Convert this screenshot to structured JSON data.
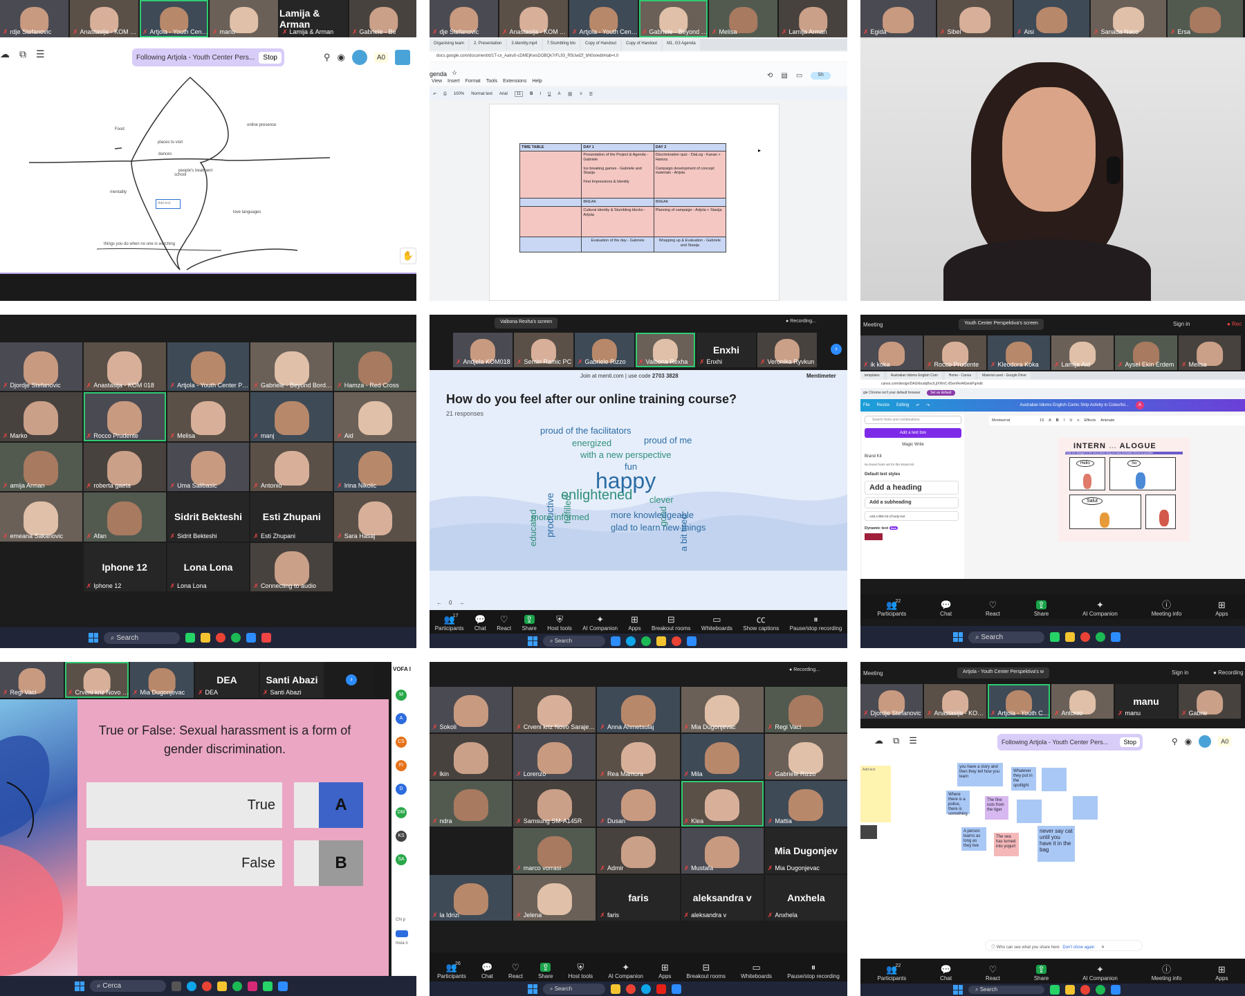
{
  "p1": {
    "participants": [
      {
        "name": "rdje Stefanovic"
      },
      {
        "name": "Anastasija - KOM 018"
      },
      {
        "name": "Artjola - Youth Center ..."
      },
      {
        "name": "manu"
      },
      {
        "name": "Lamija & Arman",
        "display": "Lamija & Arman"
      },
      {
        "name": "Gabriele - Be"
      }
    ],
    "follow_text": "Following Artjola - Youth Center Pers...",
    "stop_label": "Stop",
    "ao_label": "A0",
    "map_labels": [
      "Food",
      "online presence",
      "places to visit",
      "dances",
      "people's treatment",
      "school",
      "mentality",
      "Add text",
      "love languages",
      "things you do when no one is watching"
    ]
  },
  "p2": {
    "participants": [
      {
        "name": "dje Stefanovic"
      },
      {
        "name": "Anastasija - KOM 018"
      },
      {
        "name": "Artjola - Youth Center ..."
      },
      {
        "name": "Gabriele - Beyond Borders"
      },
      {
        "name": "Melisa"
      },
      {
        "name": "Lamija Arman"
      }
    ],
    "tabs": [
      "Organising team",
      "2. Presentation",
      "3.Identity.mp4",
      "7.Stumbling blo",
      "Copy of Handout",
      "Copy of Handout",
      "M1, G3 Agenda"
    ],
    "url": "docs.google.com/document/d/1T-cx_Aalru0-cDMEjKwsDOBQk7rFL93_R5UwlZf_bN0o/edit#tab=t.0",
    "doc_title": "genda",
    "menu": [
      "View",
      "Insert",
      "Format",
      "Tools",
      "Extensions",
      "Help"
    ],
    "format_bar": {
      "zoom": "100%",
      "style": "Normal text",
      "font": "Arial",
      "size": "11"
    },
    "table": {
      "headers": [
        "TIME TABLE",
        "DAY 1",
        "DAY 2"
      ],
      "rows": [
        {
          "day1": "Presentation of the Project & Agenda - Gabriele\n\nIce breaking games - Gabriele and Stasija\n\nFirst Impressions & Identity",
          "day2": "Discrimination quiz - DiaLog - Kanan + Hamza\n\nCampaign development of concept materials - Artjola",
          "type": "pink"
        },
        {
          "day1": "BREAK",
          "day2": "BREAK",
          "type": "blue"
        },
        {
          "day1": "Cultural identity & Stumbling blocks - Artjola",
          "day2": "Planning of campaign - Artjola + Stasija",
          "type": "pink"
        },
        {
          "day1": "Evaluation of the day - Gabriele",
          "day2": "Wrapping up & Evaluation - Gabriele and Stasija",
          "type": "blue"
        }
      ]
    }
  },
  "p3": {
    "participants": [
      {
        "name": "Egida"
      },
      {
        "name": "Sibel"
      },
      {
        "name": "Aisi"
      },
      {
        "name": "Sanada Naco"
      },
      {
        "name": "Ersa"
      }
    ]
  },
  "p4": {
    "tiles": [
      {
        "name": "Djordje Stefanovic"
      },
      {
        "name": "Anastasija - KOM 018"
      },
      {
        "name": "Artjola - Youth Center Persp..."
      },
      {
        "name": "Gabriele - Beyond Borders"
      },
      {
        "name": "Hamza - Red Cross"
      },
      {
        "name": "Marko"
      },
      {
        "name": "Rocco Prudente"
      },
      {
        "name": "Melisa"
      },
      {
        "name": "manj"
      },
      {
        "name": "Aid"
      },
      {
        "name": "amija Arman"
      },
      {
        "name": "roberta gaeta"
      },
      {
        "name": "Uma Salibasic"
      },
      {
        "name": "Antonio"
      },
      {
        "name": "Irina Nikolic"
      },
      {
        "name": "emeana Sakanovic"
      },
      {
        "name": "Afan"
      },
      {
        "name": "Sidrit Bekteshi",
        "display": "Sidrit Bekteshi"
      },
      {
        "name": "Esti Zhupani",
        "display": "Esti Zhupani"
      },
      {
        "name": "Sara Hasaj"
      },
      {
        "name": ""
      },
      {
        "name": "Iphone 12",
        "display": "Iphone 12"
      },
      {
        "name": "Lona Lona",
        "display": "Lona Lona"
      },
      {
        "name": "Connecting to audio"
      },
      {
        "name": ""
      }
    ],
    "search": "Search"
  },
  "p5": {
    "share_label": "Valbona Rexha's screen",
    "recording": "Recording...",
    "participants": [
      {
        "name": "Andjela KOM018"
      },
      {
        "name": "Semin Ramic PC"
      },
      {
        "name": "Gabriele Rizzo"
      },
      {
        "name": "Valbona Rexha"
      },
      {
        "name": "Enxhi",
        "display": "Enxhi"
      },
      {
        "name": "Veronika Ryvkun"
      }
    ],
    "join_text": "Join at menti.com | use code",
    "join_code": "2703 3828",
    "brand": "Mentimeter",
    "question": "How do you feel after  our online training course?",
    "responses": "21 responses",
    "words": [
      {
        "text": "proud of the facilitators",
        "color": "#2b6ca3"
      },
      {
        "text": "energized",
        "color": "#2f8f79"
      },
      {
        "text": "proud of me",
        "color": "#2b6ca3"
      },
      {
        "text": "with a new perspective",
        "color": "#2f8f79"
      },
      {
        "text": "fun",
        "color": "#2b6ca3"
      },
      {
        "text": "happy",
        "color": "#2b6ca3"
      },
      {
        "text": "educated",
        "color": "#2f8f79"
      },
      {
        "text": "productive",
        "color": "#2b6ca3"
      },
      {
        "text": "fulfilled",
        "color": "#2f8f79"
      },
      {
        "text": "good",
        "color": "#2f8f79"
      },
      {
        "text": "a bit tired",
        "color": "#2b6ca3"
      },
      {
        "text": "enlightened",
        "color": "#2f8f79"
      },
      {
        "text": "clever",
        "color": "#2f8f79"
      },
      {
        "text": "more informed",
        "color": "#2f8f79"
      },
      {
        "text": "more knowledgeable",
        "color": "#2b6ca3"
      },
      {
        "text": "glad to learn new things",
        "color": "#2b6ca3"
      }
    ],
    "page_counter": "0",
    "toolbar": [
      {
        "label": "Participants",
        "icon": "people",
        "count": "17"
      },
      {
        "label": "Chat",
        "icon": "chat"
      },
      {
        "label": "React",
        "icon": "heart"
      },
      {
        "label": "Share",
        "icon": "share"
      },
      {
        "label": "Host tools",
        "icon": "shield"
      },
      {
        "label": "AI Companion",
        "icon": "sparkle"
      },
      {
        "label": "Apps",
        "icon": "apps"
      },
      {
        "label": "Breakout rooms",
        "icon": "grid"
      },
      {
        "label": "Whiteboards",
        "icon": "board"
      },
      {
        "label": "Show captions",
        "icon": "cc"
      },
      {
        "label": "Pause/stop recording",
        "icon": "pause"
      }
    ],
    "search": "Search"
  },
  "p6": {
    "meeting": "Meeting",
    "share_label": "Youth Center Perspektiva's screen",
    "sign_in": "Sign in",
    "recording": "Rec",
    "participants": [
      {
        "name": "ik koka"
      },
      {
        "name": "Rocco Prudente"
      },
      {
        "name": "Kleodora Koka"
      },
      {
        "name": "Lamija Aid"
      },
      {
        "name": "Aysel Ekin Erdem"
      },
      {
        "name": "Melisa"
      }
    ],
    "tabs": [
      "templates",
      "Australian Idioms English Com",
      "Home - Canva",
      "Material used - Google Drive"
    ],
    "url": "canva.com/design/DAGhbudqBvc/LjIXWxC-8SenReAKbelsPg/edit",
    "notice": "gle Chrome isn't your default browser",
    "notice_btn": "Set as default",
    "menu": {
      "file": "File",
      "resize": "Resize",
      "editing": "Editing"
    },
    "doc_title": "Australian Idioms English Comic Strip Activity in Colourful...",
    "avatar": "A",
    "font": "Montserrat",
    "font_size": "13",
    "effects": "Effects",
    "animate": "Animate",
    "search_fonts": "Search fonts and combinations",
    "add_text_box": "Add a text box",
    "magic_write": "Magic Write",
    "brand_kit": "Brand Kit",
    "no_brand": "No brand fonts set for this Brand Kit",
    "default_styles": "Default text styles",
    "add_heading": "Add a heading",
    "add_subheading": "Add a subheading",
    "add_body": "Add a little bit of body text",
    "dynamic_text": "Dynamic text",
    "new_badge": "New",
    "comic_title": "INTERN",
    "comic_title2": "ALOGUE",
    "comic_sub": "Finish the dialogue in the story below using as many Australian idioms as possible",
    "bubble_hello": "Hello",
    "bubble_so": "So",
    "bubble_salut": "Salut",
    "toolbar": [
      {
        "label": "Participants",
        "icon": "people",
        "count": "22"
      },
      {
        "label": "Chat",
        "icon": "chat"
      },
      {
        "label": "React",
        "icon": "heart"
      },
      {
        "label": "Share",
        "icon": "share"
      },
      {
        "label": "AI Companion",
        "icon": "sparkle"
      },
      {
        "label": "Meeting info",
        "icon": "info"
      },
      {
        "label": "Apps",
        "icon": "apps"
      }
    ],
    "search": "Search"
  },
  "p7": {
    "participants": [
      {
        "name": "Regi Vaci"
      },
      {
        "name": "Crveni kriz Novo Sarajevo"
      },
      {
        "name": "Mia Dugonjevac"
      },
      {
        "name": "DEA",
        "display": "DEA"
      },
      {
        "name": "Santi Abazi",
        "display": "Santi Abazi"
      }
    ],
    "question": "True or False: Sexual harassment is a form of gender discrimination.",
    "options": [
      {
        "text": "True",
        "letter": "A",
        "color": "#3d63c9"
      },
      {
        "text": "False",
        "letter": "B",
        "color": "#9a9a9a"
      }
    ],
    "side_title": "VOFA I",
    "side_letters": [
      "M",
      "A",
      "CS",
      "FI",
      "D",
      "DM",
      "KS",
      "SA"
    ],
    "side_chat": "Chi p",
    "side_invite": "Invia n",
    "search": "Cerca"
  },
  "p8": {
    "recording": "Recording...",
    "tiles": [
      {
        "name": "Sokoli"
      },
      {
        "name": "Crveni kriz Novo Sarajevo"
      },
      {
        "name": "Anna Ahmetsulaj"
      },
      {
        "name": "Mia Dugonjevac"
      },
      {
        "name": "Regi Vaci"
      },
      {
        "name": "lkin"
      },
      {
        "name": "Lorenzo"
      },
      {
        "name": "Rea Mamura"
      },
      {
        "name": "Mila"
      },
      {
        "name": "Gabriele Rizzo"
      },
      {
        "name": "ndra"
      },
      {
        "name": "Samsung SM-A145R"
      },
      {
        "name": "Dusan"
      },
      {
        "name": "Klea"
      },
      {
        "name": "Mattia"
      },
      {
        "name": ""
      },
      {
        "name": "marco vorrasi"
      },
      {
        "name": "Admir"
      },
      {
        "name": "Mustafa"
      },
      {
        "name": "Mia Dugonjevac",
        "display": "Mia Dugonjev"
      },
      {
        "name": "la Idrizi"
      },
      {
        "name": "Jelena"
      },
      {
        "name": "faris",
        "display": "faris"
      },
      {
        "name": "aleksandra v",
        "display": "aleksandra v"
      },
      {
        "name": "Anxhela",
        "display": "Anxhela"
      }
    ],
    "toolbar": [
      {
        "label": "Participants",
        "icon": "people",
        "count": "26"
      },
      {
        "label": "Chat",
        "icon": "chat"
      },
      {
        "label": "React",
        "icon": "heart"
      },
      {
        "label": "Share",
        "icon": "share"
      },
      {
        "label": "Host tools",
        "icon": "shield"
      },
      {
        "label": "AI Companion",
        "icon": "sparkle"
      },
      {
        "label": "Apps",
        "icon": "apps"
      },
      {
        "label": "Breakout rooms",
        "icon": "grid"
      },
      {
        "label": "Whiteboards",
        "icon": "board"
      },
      {
        "label": "Pause/stop recording",
        "icon": "pause"
      }
    ],
    "search": "Search"
  },
  "p9": {
    "meeting": "Meeting",
    "share_label": "Artjola - Youth Center Perspektiva's w",
    "sign_in": "Sign in",
    "recording": "Recording",
    "participants": [
      {
        "name": "Djordje Stefanovic"
      },
      {
        "name": "Anastasija - KOM 018"
      },
      {
        "name": "Artjola - Youth Center Per..."
      },
      {
        "name": "Antonio"
      },
      {
        "name": "manu",
        "display": "manu"
      },
      {
        "name": "Gabrie"
      }
    ],
    "follow_text": "Following Artjola - Youth Center Pers...",
    "stop_label": "Stop",
    "ao_label": "A0",
    "stickies": [
      {
        "text": "you have a story and then they tell how you learn",
        "color": "#a9c8f5"
      },
      {
        "text": "Whatever they put in the spotlight",
        "color": "#a9c8f5"
      },
      {
        "text": "",
        "color": "#a9c8f5"
      },
      {
        "text": "Where there is a police, there is something",
        "color": "#a9c8f5"
      },
      {
        "text": "The fine cuts from the tiger",
        "color": "#d7b8f0"
      },
      {
        "text": "",
        "color": "#a9c8f5"
      },
      {
        "text": "",
        "color": "#a9c8f5"
      },
      {
        "text": "A person learns as long as they live",
        "color": "#a9c8f5"
      },
      {
        "text": "The sea has turned into yogurt",
        "color": "#f5b8b8"
      },
      {
        "text": "never say cat until you have it in the bag",
        "color": "#a9c8f5"
      }
    ],
    "yellow_note": "Add text",
    "notice": "Who can see what you share here",
    "notice_link": "Don't show again",
    "toolbar": [
      {
        "label": "Participants",
        "icon": "people",
        "count": "22"
      },
      {
        "label": "Chat",
        "icon": "chat"
      },
      {
        "label": "React",
        "icon": "heart"
      },
      {
        "label": "Share",
        "icon": "share"
      },
      {
        "label": "AI Companion",
        "icon": "sparkle"
      },
      {
        "label": "Meeting info",
        "icon": "info"
      },
      {
        "label": "Apps",
        "icon": "apps"
      }
    ],
    "search": "Search"
  }
}
